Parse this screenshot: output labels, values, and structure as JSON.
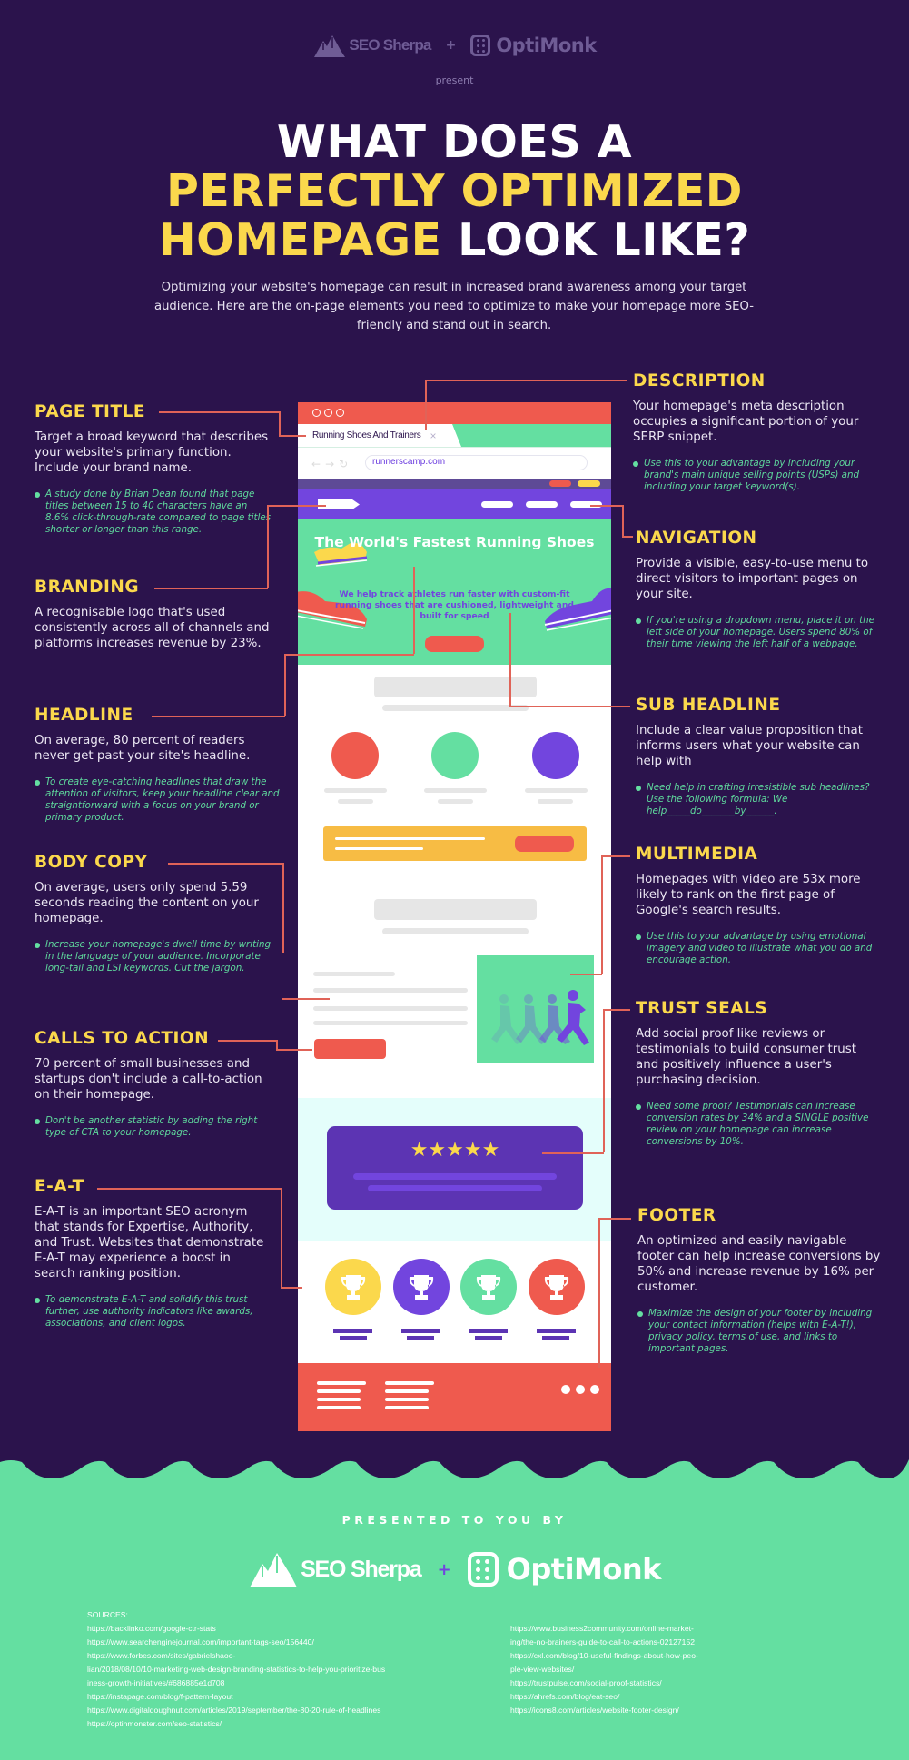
{
  "header": {
    "brand_left": "SEO Sherpa",
    "plus": "+",
    "brand_right": "OptiMonk",
    "present": "present",
    "title_line1": "WHAT DOES A",
    "title_line2": "PERFECTLY OPTIMIZED",
    "title_line3_yellow": "HOMEPAGE",
    "title_line3_white": "LOOK LIKE?",
    "intro": "Optimizing your website's homepage can result in increased brand awareness among your target audience. Here are the on-page elements you need to optimize to make your homepage more SEO-friendly and stand out in search."
  },
  "sections_left": [
    {
      "title": "PAGE TITLE",
      "body": "Target a broad keyword that describes your website's primary function. Include your brand name.",
      "tip": "A study done by Brian Dean found that page titles between 15 to 40 characters have an 8.6% click-through-rate compared to page titles shorter or longer than this range."
    },
    {
      "title": "BRANDING",
      "body": "A recognisable logo that's used consistently across all of channels and platforms increases revenue by 23%.",
      "tip": ""
    },
    {
      "title": "HEADLINE",
      "body": "On average, 80 percent of readers never get past your site's headline.",
      "tip": "To create eye-catching headlines that draw the attention of visitors, keep your headline clear and straightforward with a focus on your brand or primary product."
    },
    {
      "title": "BODY COPY",
      "body": "On average, users only spend 5.59 seconds reading the content on your homepage.",
      "tip": "Increase your homepage's dwell time by writing in the language of your audience. Incorporate long-tail and LSI keywords. Cut the jargon."
    },
    {
      "title": "CALLS TO ACTION",
      "body": "70 percent of small businesses and startups don't include a call-to-action on their homepage.",
      "tip": "Don't be another statistic by adding the right type of CTA to your homepage."
    },
    {
      "title": "E-A-T",
      "body": "E-A-T is an important SEO acronym that stands for Expertise, Authority, and Trust. Websites that demonstrate E-A-T may experience a boost in search ranking position.",
      "tip": "To demonstrate E-A-T and solidify this trust further, use authority indicators like awards, associations, and client logos."
    }
  ],
  "sections_right": [
    {
      "title": "DESCRIPTION",
      "body": "Your homepage's meta description occupies a significant portion of your SERP snippet.",
      "tip": "Use this to your advantage by including your brand's main unique selling points (USPs) and including your target keyword(s)."
    },
    {
      "title": "NAVIGATION",
      "body": "Provide a visible, easy-to-use menu to direct visitors to important pages on your site.",
      "tip": "If you're using a dropdown menu, place it on the left side of your homepage. Users spend 80% of their time viewing the left half of a webpage."
    },
    {
      "title": "SUB HEADLINE",
      "body": "Include a clear value proposition that informs users what your website can help with",
      "tip": "Need help in crafting irresistible sub headlines? Use the following formula: We help_____do_______by______."
    },
    {
      "title": "MULTIMEDIA",
      "body": "Homepages with video are 53x more likely to rank on the first page of Google's search results.",
      "tip": "Use this to your advantage by using emotional imagery and video to illustrate what you do and encourage action."
    },
    {
      "title": "TRUST SEALS",
      "body": "Add social proof like reviews or testimonials to build consumer trust and positively influence a user's purchasing decision.",
      "tip": "Need some proof? Testimonials can increase conversion rates by 34% and a SINGLE positive review on your homepage can increase conversions by 10%."
    },
    {
      "title": "FOOTER",
      "body": "An optimized and easily navigable footer can help increase conversions by 50% and increase revenue by 16% per customer.",
      "tip": "Maximize the design of your footer by including your contact information (helps with E-A-T!), privacy policy, terms of use, and links to important pages."
    }
  ],
  "mockup": {
    "tab_title": "Running Shoes And Trainers",
    "tab_close": "×",
    "url": "runnerscamp.com",
    "nav_back": "←",
    "nav_forward": "→",
    "nav_reload": "↻",
    "hero_headline": "The World's Fastest Running Shoes",
    "hero_subheadline": "We help track athletes run faster with custom-fit running shoes that are cushioned, lightweight and built for speed",
    "stars": "★★★★★",
    "rating": 5,
    "colors": {
      "red": "#ef5a4e",
      "green": "#64dfa1",
      "purple": "#7245de",
      "yellow": "#fbd84c",
      "dark": "#2b134c"
    }
  },
  "footer": {
    "presented": "PRESENTED TO YOU BY",
    "brand_left": "SEO Sherpa",
    "plus": "+",
    "brand_right": "OptiMonk",
    "sources_label": "SOURCES:",
    "sources_left": [
      "https://backlinko.com/google-ctr-stats",
      "https://www.searchenginejournal.com/important-tags-seo/156440/",
      "https://www.forbes.com/sites/gabrielshaoo-",
      "lian/2018/08/10/10-marketing-web-design-branding-statistics-to-help-you-prioritize-bus",
      "iness-growth-initiatives/#686885e1d708",
      "https://instapage.com/blog/f-pattern-layout",
      "https://www.digitaldoughnut.com/articles/2019/september/the-80-20-rule-of-headlines",
      "https://optinmonster.com/seo-statistics/"
    ],
    "sources_right": [
      "https://www.business2community.com/online-market-",
      "ing/the-no-brainers-guide-to-call-to-actions-02127152",
      "https://cxl.com/blog/10-useful-findings-about-how-peo-",
      "ple-view-websites/",
      "https://trustpulse.com/social-proof-statistics/",
      "https://ahrefs.com/blog/eat-seo/",
      "https://icons8.com/articles/website-footer-design/"
    ]
  }
}
